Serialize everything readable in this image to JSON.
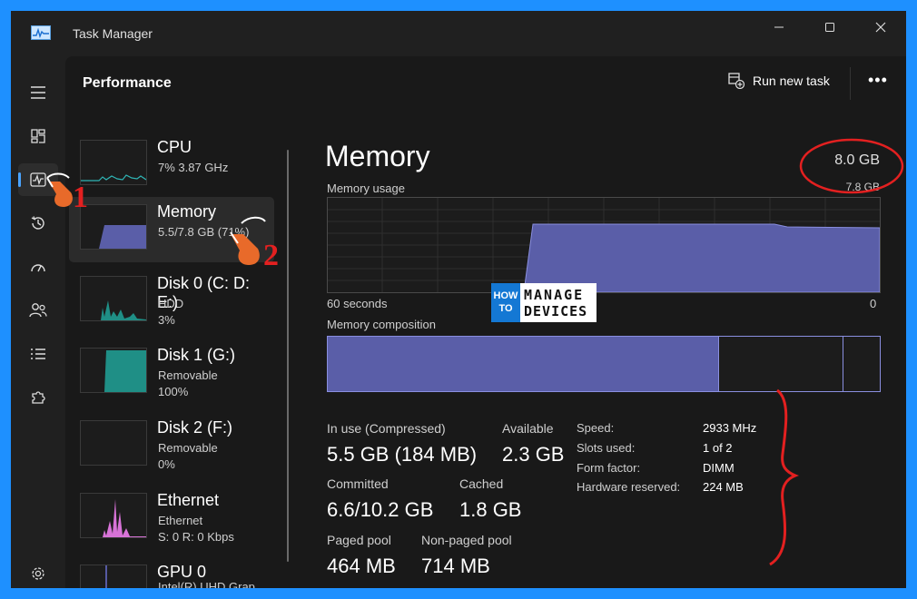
{
  "window": {
    "title": "Task Manager"
  },
  "header": {
    "page_title": "Performance",
    "run_task_label": "Run new task",
    "more_label": "•••"
  },
  "rail": {
    "items": [
      "hamburger-menu",
      "processes",
      "performance",
      "app-history",
      "startup-apps",
      "users",
      "details",
      "services",
      "settings"
    ]
  },
  "resources": [
    {
      "name": "CPU",
      "line2": "7%  3.87 GHz",
      "line3": ""
    },
    {
      "name": "Memory",
      "line2": "5.5/7.8 GB (71%)",
      "line3": ""
    },
    {
      "name": "Disk 0 (C: D: E:)",
      "line2": "HDD",
      "line3": "3%"
    },
    {
      "name": "Disk 1 (G:)",
      "line2": "Removable",
      "line3": "100%"
    },
    {
      "name": "Disk 2 (F:)",
      "line2": "Removable",
      "line3": "0%"
    },
    {
      "name": "Ethernet",
      "line2": "Ethernet",
      "line3": "S: 0  R: 0 Kbps"
    },
    {
      "name": "GPU 0",
      "line2": "Intel(R) UHD Grap...",
      "line3": ""
    }
  ],
  "detail": {
    "title": "Memory",
    "total": "8.0 GB",
    "usable": "7.8 GB",
    "usage_label": "Memory usage",
    "x_left": "60 seconds",
    "x_right": "0",
    "composition_label": "Memory composition",
    "stats": {
      "in_use_label": "In use (Compressed)",
      "in_use_value": "5.5 GB (184 MB)",
      "available_label": "Available",
      "available_value": "2.3 GB",
      "committed_label": "Committed",
      "committed_value": "6.6/10.2 GB",
      "cached_label": "Cached",
      "cached_value": "1.8 GB",
      "paged_label": "Paged pool",
      "paged_value": "464 MB",
      "nonpaged_label": "Non-paged pool",
      "nonpaged_value": "714 MB"
    },
    "specs": [
      {
        "key": "Speed:",
        "value": "2933 MHz"
      },
      {
        "key": "Slots used:",
        "value": "1 of 2"
      },
      {
        "key": "Form factor:",
        "value": "DIMM"
      },
      {
        "key": "Hardware reserved:",
        "value": "224 MB"
      }
    ]
  },
  "logo": {
    "how": "HOW",
    "to": "TO",
    "manage": "MANAGE",
    "devices": "DEVICES"
  },
  "annotations": {
    "step1": "1",
    "step2": "2",
    "color": "#e32020"
  },
  "colors": {
    "accent": "#4aa3ff",
    "memory_fill": "#5a5ea8",
    "cpu_line": "#2fb5b5",
    "disk_fill": "#1f8f86",
    "eth_fill": "#d873d8"
  }
}
